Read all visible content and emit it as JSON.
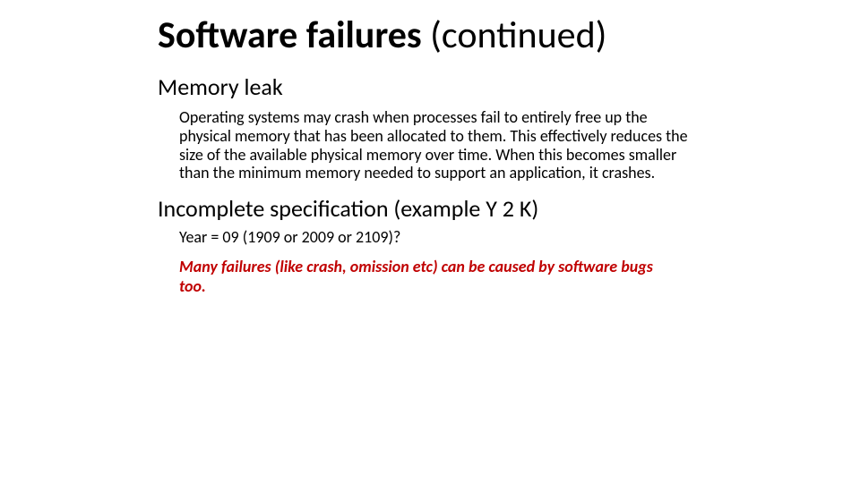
{
  "title_main": "Software failures ",
  "title_cont": "(continued)",
  "section1_heading": "Memory leak",
  "section1_body": "Operating systems may crash when processes fail to entirely free up the physical memory that has been allocated to them. This effectively reduces the size of the available physical memory over time. When this becomes smaller than the minimum memory needed to support an application, it crashes.",
  "section2_heading": "Incomplete specification (example Y 2 K)",
  "section2_body": "Year = 09 (1909 or 2009 or 2109)?",
  "closing": "Many failures (like crash, omission etc) can be caused by software bugs too."
}
